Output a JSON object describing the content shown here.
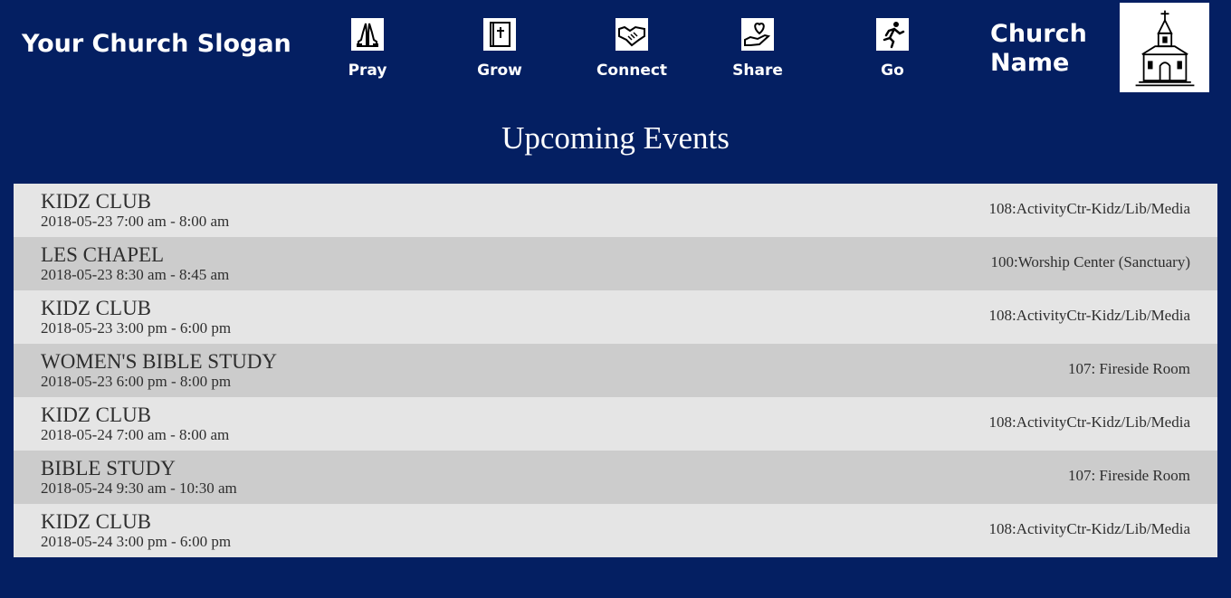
{
  "header": {
    "slogan": "Your Church Slogan",
    "nav": [
      {
        "label": "Pray",
        "icon": "praying-hands-icon"
      },
      {
        "label": "Grow",
        "icon": "bible-icon"
      },
      {
        "label": "Connect",
        "icon": "handshake-icon"
      },
      {
        "label": "Share",
        "icon": "heart-hand-icon"
      },
      {
        "label": "Go",
        "icon": "running-person-icon"
      }
    ],
    "church_name": "Church Name",
    "logo_icon": "church-icon"
  },
  "events_section": {
    "title": "Upcoming Events",
    "events": [
      {
        "title": "KIDZ CLUB",
        "time": "2018-05-23 7:00 am - 8:00 am",
        "location": "108:ActivityCtr-Kidz/Lib/Media"
      },
      {
        "title": "LES CHAPEL",
        "time": "2018-05-23 8:30 am - 8:45 am",
        "location": "100:Worship Center (Sanctuary)"
      },
      {
        "title": "KIDZ CLUB",
        "time": "2018-05-23 3:00 pm - 6:00 pm",
        "location": "108:ActivityCtr-Kidz/Lib/Media"
      },
      {
        "title": "WOMEN'S BIBLE STUDY",
        "time": "2018-05-23 6:00 pm - 8:00 pm",
        "location": "107: Fireside Room"
      },
      {
        "title": "KIDZ CLUB",
        "time": "2018-05-24 7:00 am - 8:00 am",
        "location": "108:ActivityCtr-Kidz/Lib/Media"
      },
      {
        "title": "BIBLE STUDY",
        "time": "2018-05-24 9:30 am - 10:30 am",
        "location": "107: Fireside Room"
      },
      {
        "title": "KIDZ CLUB",
        "time": "2018-05-24 3:00 pm - 6:00 pm",
        "location": "108:ActivityCtr-Kidz/Lib/Media"
      }
    ]
  },
  "colors": {
    "background": "#041f62",
    "row_light": "#e5e5e5",
    "row_dark": "#cccccc",
    "text_dark": "#2e2e2e"
  }
}
